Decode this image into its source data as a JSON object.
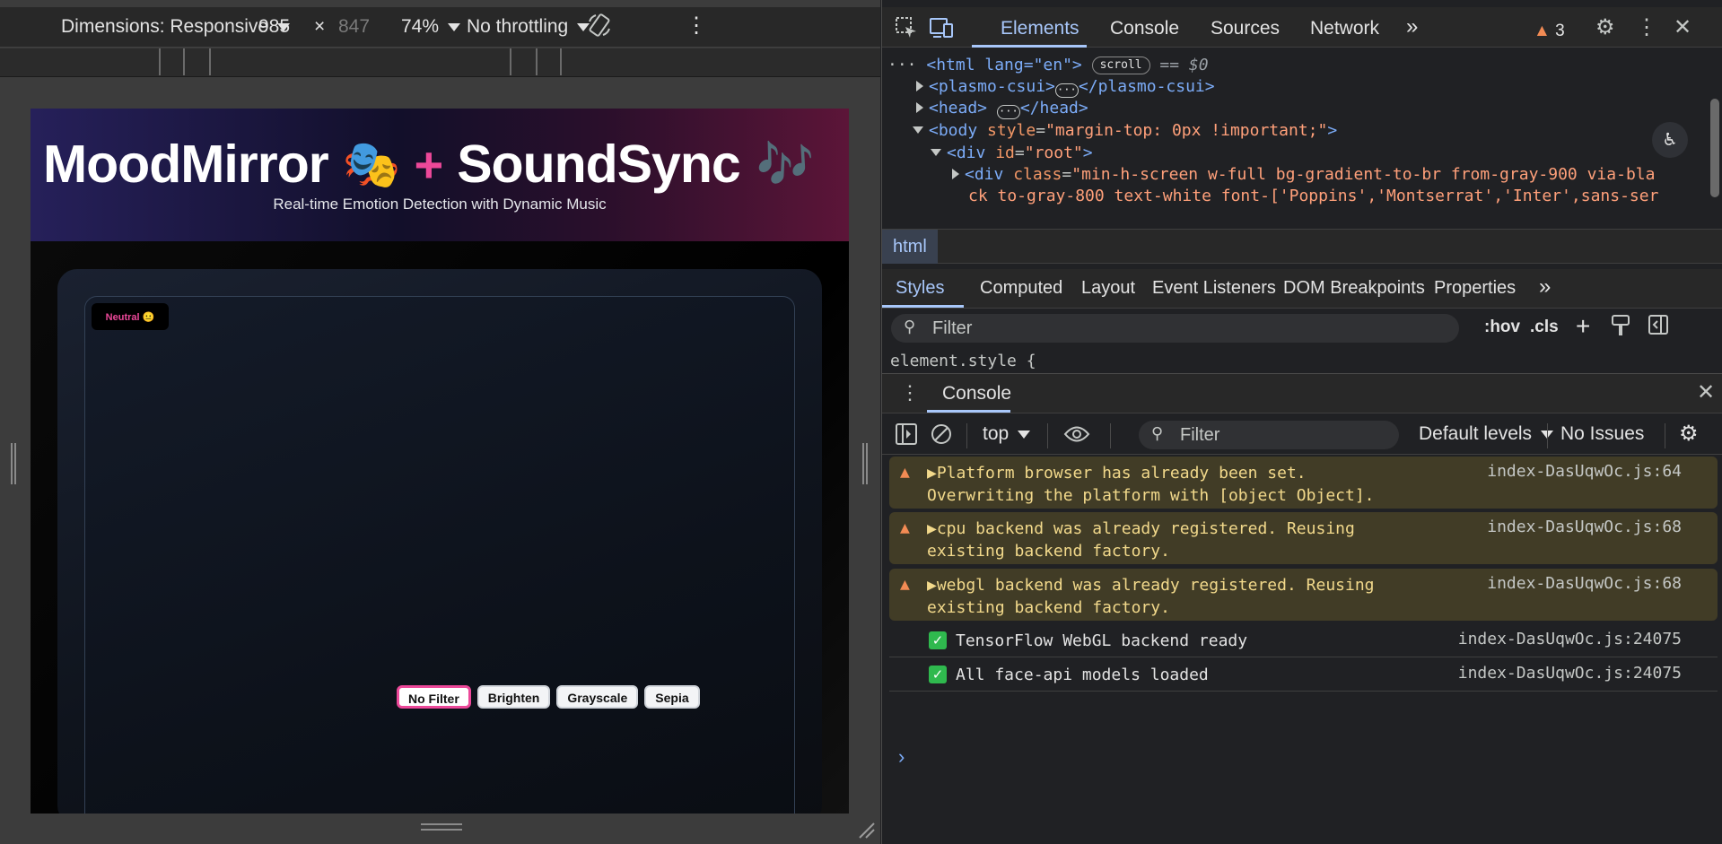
{
  "device_toolbar": {
    "dimensions_label": "Dimensions: Responsive",
    "width": "985",
    "times": "×",
    "height": "847",
    "zoom": "74%",
    "throttling": "No throttling"
  },
  "app": {
    "title_part1": "MoodMirror",
    "title_icon1": "🎭",
    "title_plus": "+",
    "title_part2": "SoundSync",
    "title_icon2": "🎶",
    "subtitle": "Real-time Emotion Detection with Dynamic Music",
    "emotion_badge": "Neutral 😐",
    "filters": [
      {
        "label": "No Filter",
        "active": true
      },
      {
        "label": "Brighten",
        "active": false
      },
      {
        "label": "Grayscale",
        "active": false
      },
      {
        "label": "Sepia",
        "active": false
      }
    ]
  },
  "devtools": {
    "tabs": [
      "Elements",
      "Console",
      "Sources",
      "Network"
    ],
    "more_tabs": "»",
    "warning_count": "3",
    "dom": {
      "line0_tag": "<html lang=\"en\">",
      "line0_pill": "scroll",
      "line0_suffix": "== $0",
      "line1": "<plasmo-csui>",
      "line1_close": "</plasmo-csui>",
      "line2": "<head>",
      "line2_close": "</head>",
      "line3_tag": "<body",
      "line3_attr": "style",
      "line3_val": "\"margin-top: 0px !important;\"",
      "line4_tag": "<div",
      "line4_attr": "id",
      "line4_val": "\"root\"",
      "line5_tag": "<div",
      "line5_attr": "class",
      "line5_val1": "\"min-h-screen w-full bg-gradient-to-br from-gray-900 via-bla",
      "line5_val2": "ck to-gray-800 text-white font-['Poppins','Montserrat','Inter',sans-ser"
    },
    "breadcrumb": "html",
    "styles_tabs": [
      "Styles",
      "Computed",
      "Layout",
      "Event Listeners",
      "DOM Breakpoints",
      "Properties"
    ],
    "styles_filter_placeholder": "Filter",
    "styles_tools": {
      "hov": ":hov",
      "cls": ".cls"
    },
    "element_style": "element.style {",
    "drawer_tab": "Console",
    "console_toolbar": {
      "context": "top",
      "filter_placeholder": "Filter",
      "levels": "Default levels",
      "issues": "No Issues"
    },
    "console_messages": [
      {
        "type": "warn",
        "text": "▶Platform browser has already been set.\nOverwriting the platform with [object Object].",
        "source": "index-DasUqwOc.js:64"
      },
      {
        "type": "warn",
        "text": "▶cpu backend was already registered. Reusing\nexisting backend factory.",
        "source": "index-DasUqwOc.js:68"
      },
      {
        "type": "warn",
        "text": "▶webgl backend was already registered. Reusing\nexisting backend factory.",
        "source": "index-DasUqwOc.js:68"
      },
      {
        "type": "log",
        "text": "TensorFlow WebGL backend ready",
        "source": "index-DasUqwOc.js:24075"
      },
      {
        "type": "log",
        "text": "All face-api models loaded",
        "source": "index-DasUqwOc.js:24075"
      }
    ],
    "prompt": "›"
  },
  "colors": {
    "accent_blue": "#a8c7fa",
    "warning_orange": "#f28b54",
    "pink": "#ec4899",
    "success_green": "#2fb94e"
  }
}
